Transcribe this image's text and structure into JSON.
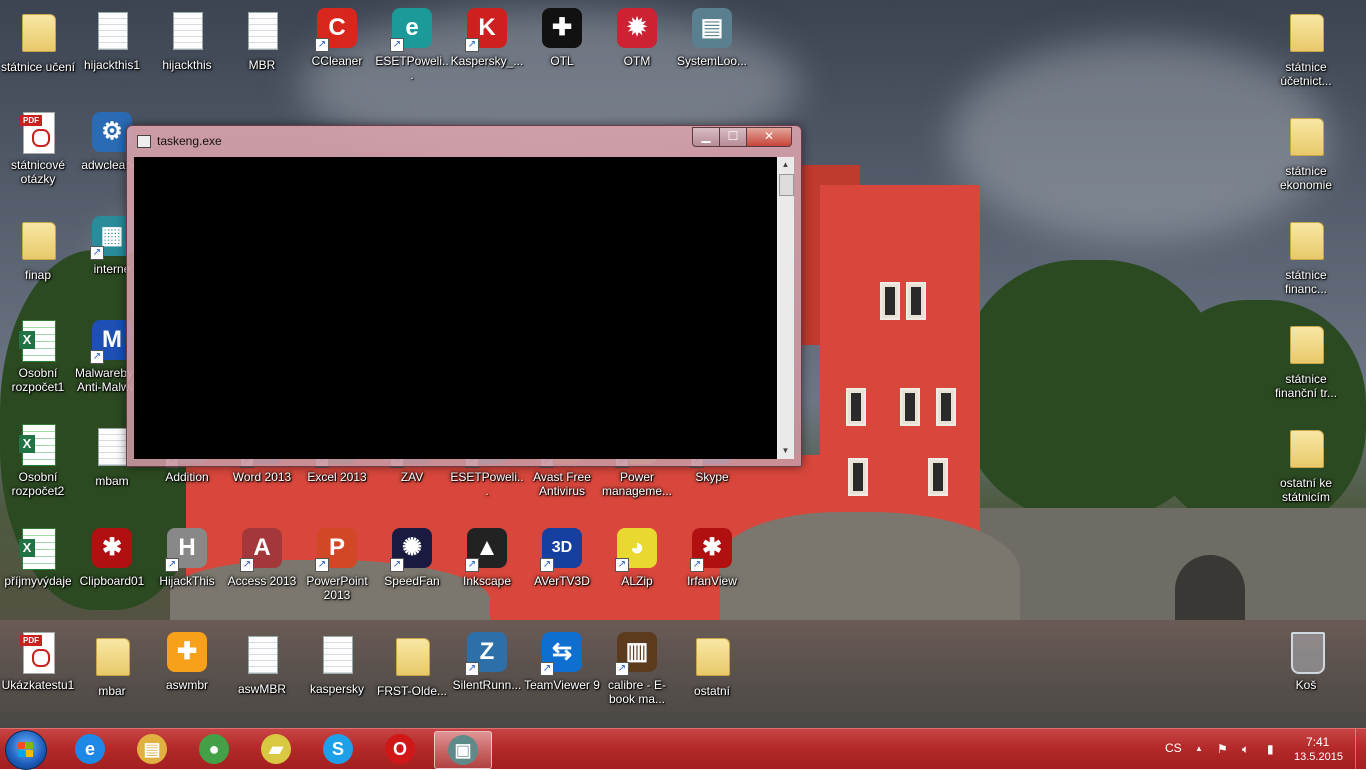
{
  "desktop": {
    "icons": [
      {
        "label": "státnice učení",
        "type": "folder"
      },
      {
        "label": "hijackthis1",
        "type": "doc"
      },
      {
        "label": "hijackthis",
        "type": "doc"
      },
      {
        "label": "MBR",
        "type": "doc"
      },
      {
        "label": "CCleaner",
        "type": "app"
      },
      {
        "label": "ESETPoweli...",
        "type": "app"
      },
      {
        "label": "Kaspersky_...",
        "type": "app"
      },
      {
        "label": "OTL",
        "type": "app"
      },
      {
        "label": "OTM",
        "type": "app"
      },
      {
        "label": "SystemLoo...",
        "type": "app"
      },
      {
        "label": "státnicové otázky",
        "type": "pdf"
      },
      {
        "label": "adwcleaner",
        "type": "app"
      },
      {
        "label": "finap",
        "type": "folder"
      },
      {
        "label": "interne",
        "type": "app"
      },
      {
        "label": "Osobní rozpočet1",
        "type": "xls"
      },
      {
        "label": "Malwarebytes Anti-Malware",
        "type": "app"
      },
      {
        "label": "Osobní rozpočet2",
        "type": "xls"
      },
      {
        "label": "mbam",
        "type": "doc"
      },
      {
        "label": "Addition",
        "type": "app"
      },
      {
        "label": "Word 2013",
        "type": "app"
      },
      {
        "label": "Excel 2013",
        "type": "app"
      },
      {
        "label": "ZAV",
        "type": "app"
      },
      {
        "label": "ESETPoweli...",
        "type": "app"
      },
      {
        "label": "Avast Free Antivirus",
        "type": "app"
      },
      {
        "label": "Power manageme...",
        "type": "app"
      },
      {
        "label": "Skype",
        "type": "app"
      },
      {
        "label": "příjmyvýdaje",
        "type": "xls"
      },
      {
        "label": "Clipboard01",
        "type": "app"
      },
      {
        "label": "HijackThis",
        "type": "app"
      },
      {
        "label": "Access 2013",
        "type": "app"
      },
      {
        "label": "PowerPoint 2013",
        "type": "app"
      },
      {
        "label": "SpeedFan",
        "type": "app"
      },
      {
        "label": "Inkscape",
        "type": "app"
      },
      {
        "label": "AVerTV3D",
        "type": "app"
      },
      {
        "label": "ALZip",
        "type": "app"
      },
      {
        "label": "IrfanView",
        "type": "app"
      },
      {
        "label": "Ukázkatestu1",
        "type": "pdf"
      },
      {
        "label": "mbar",
        "type": "folder"
      },
      {
        "label": "aswmbr",
        "type": "app"
      },
      {
        "label": "aswMBR",
        "type": "doc"
      },
      {
        "label": "kaspersky",
        "type": "doc"
      },
      {
        "label": "FRST-Olde...",
        "type": "folder"
      },
      {
        "label": "SilentRunn...",
        "type": "app"
      },
      {
        "label": "TeamViewer 9",
        "type": "app"
      },
      {
        "label": "calibre - E-book ma...",
        "type": "app"
      },
      {
        "label": "ostatní",
        "type": "folder"
      },
      {
        "label": "státnice účetnict...",
        "type": "folder"
      },
      {
        "label": "státnice ekonomie",
        "type": "folder"
      },
      {
        "label": "státnice financ...",
        "type": "folder"
      },
      {
        "label": "státnice finanční tr...",
        "type": "folder"
      },
      {
        "label": "ostatní ke státnicím",
        "type": "folder"
      },
      {
        "label": "Koš",
        "type": "recycle"
      }
    ]
  },
  "window": {
    "title": "taskeng.exe",
    "min_label": "▁",
    "max_label": "☐",
    "close_label": "✕",
    "scroll_up": "▲",
    "scroll_down": "▼"
  },
  "taskbar": {
    "pinned": [
      {
        "name": "Internet Explorer",
        "icon": "ie-icon",
        "glyph": "e",
        "color": "#1e88e5"
      },
      {
        "name": "File Explorer",
        "icon": "folder-icon",
        "glyph": "▤",
        "color": "#e0b040"
      },
      {
        "name": "Chrome",
        "icon": "chrome-icon",
        "glyph": "●",
        "color": "#43a047"
      },
      {
        "name": "Sticky Notes",
        "icon": "notes-icon",
        "glyph": "▰",
        "color": "#d8c842"
      },
      {
        "name": "Skype",
        "icon": "skype-icon",
        "glyph": "S",
        "color": "#1ea0e8"
      },
      {
        "name": "Opera",
        "icon": "opera-icon",
        "glyph": "O",
        "color": "#d01818"
      },
      {
        "name": "taskeng.exe",
        "icon": "console-icon",
        "glyph": "▣",
        "color": "#5f8a8a"
      }
    ],
    "language": "CS",
    "tray_arrow": "▲",
    "time": "7:41",
    "date": "13.5.2015"
  },
  "colors": {
    "taskbar": "#b52a2a",
    "window_frame": "#d6a0aa"
  }
}
